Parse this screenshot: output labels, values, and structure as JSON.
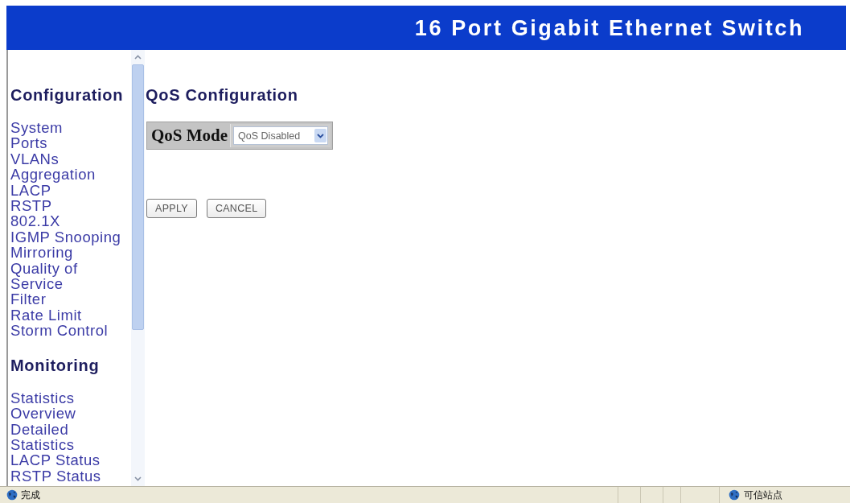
{
  "header": {
    "title": "16 Port Gigabit Ethernet Switch"
  },
  "sidebar": {
    "sections": [
      {
        "heading": "Configuration",
        "items": [
          "System",
          "Ports",
          "VLANs",
          "Aggregation",
          "LACP",
          "RSTP",
          "802.1X",
          "IGMP Snooping",
          "Mirroring",
          "Quality of Service",
          "Filter",
          "Rate Limit",
          "Storm Control"
        ]
      },
      {
        "heading": "Monitoring",
        "items": [
          "Statistics Overview",
          "Detailed Statistics",
          "LACP Status",
          "RSTP Status"
        ]
      }
    ]
  },
  "main": {
    "title": "QoS Configuration",
    "qos_mode": {
      "label": "QoS Mode",
      "value": "QoS Disabled"
    },
    "buttons": [
      "APPLY",
      "CANCEL"
    ]
  },
  "status_bar": {
    "status": "完成",
    "zone": "可信站点"
  }
}
